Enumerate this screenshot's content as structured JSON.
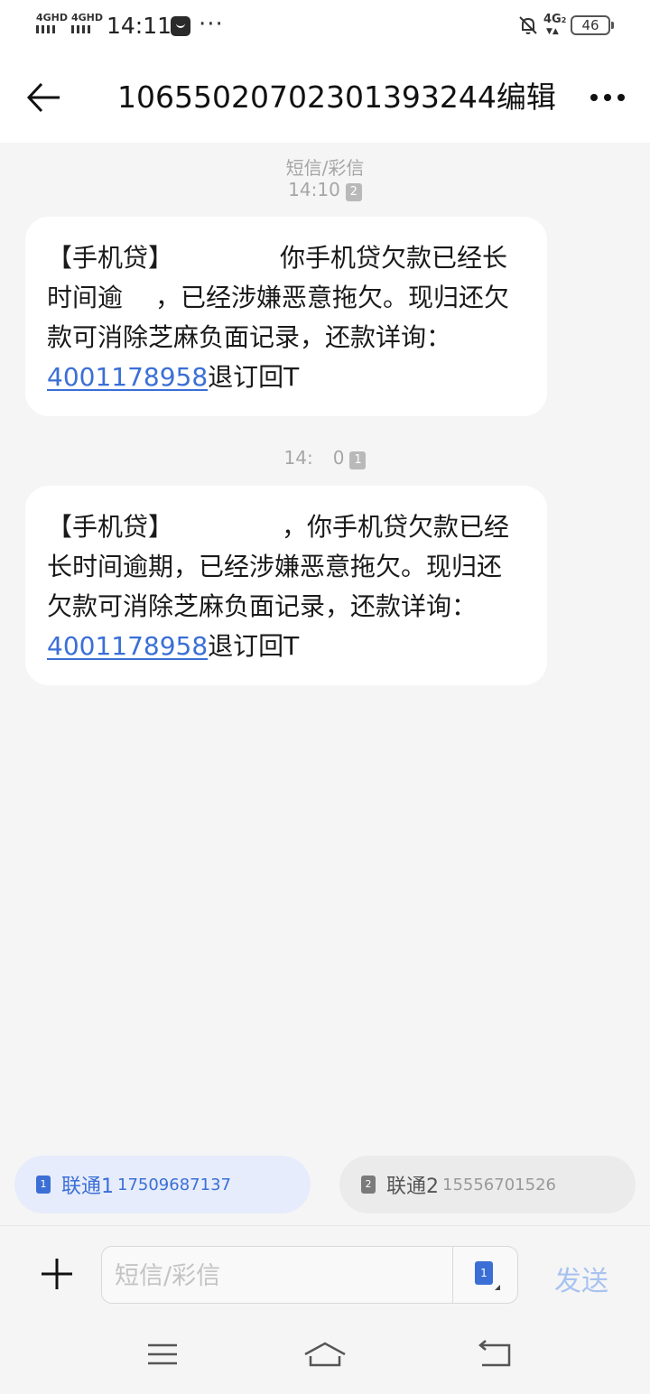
{
  "status_bar": {
    "sim1_label": "4GHD",
    "sim2_label": "4GHD",
    "time": "14:11",
    "more": "···",
    "network": "4G",
    "network_sub": "2",
    "battery": "46"
  },
  "header": {
    "title": "10655020702301393244编辑",
    "icons": [
      "back-arrow-icon",
      "more-options-icon"
    ]
  },
  "conversation": {
    "message_type": "短信/彩信",
    "messages": [
      {
        "time": "14:10",
        "sim": "2",
        "text_before": "【手机贷】",
        "text_after": "你手机贷欠款已经长时间逾",
        "text_after_2": "，已经涉嫌恶意拖欠。现归还欠款可消除芝麻负面记录，还款详询：",
        "phone": "4001178958",
        "suffix": "退订回T"
      },
      {
        "time": "14:",
        "time_end": "0",
        "sim": "1",
        "text_before": "【手机贷】",
        "text_after": "，你手机贷欠款已经长时间逾期，已经涉嫌恶意拖欠。现归还欠款可消除芝麻负面记录，还款详询：",
        "phone": "4001178958",
        "suffix": "退订回T"
      }
    ]
  },
  "sim_selector": {
    "sim1": {
      "index": "1",
      "name": "联通1",
      "number": "17509687137",
      "selected": true
    },
    "sim2": {
      "index": "2",
      "name": "联通2",
      "number": "15556701526",
      "selected": false
    }
  },
  "composer": {
    "placeholder": "短信/彩信",
    "sim_index": "1",
    "send_label": "发送"
  },
  "colors": {
    "accent": "#3b6fd6",
    "send_disabled": "#a9c3f0",
    "background": "#f5f5f5",
    "bubble": "#ffffff"
  },
  "navbar_icons": [
    "menu-icon",
    "home-icon",
    "back-icon"
  ]
}
